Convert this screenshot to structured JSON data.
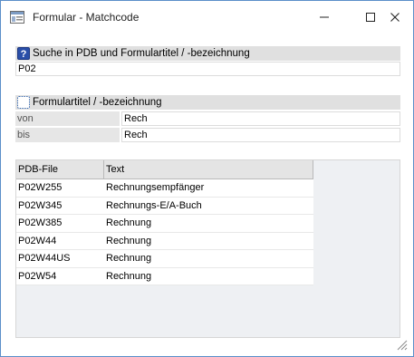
{
  "window": {
    "title": "Formular - Matchcode",
    "icons": {
      "app": "form-window-icon",
      "minimize": "minimize-icon",
      "maximize": "maximize-icon",
      "close": "close-icon"
    }
  },
  "search_section": {
    "header_icon": "help-question-icon",
    "header_label": "Suche in PDB und Formulartitel / -bezeichnung",
    "value": "P02"
  },
  "range_section": {
    "header_icon": "dotted-selection-icon",
    "header_label": "Formulartitel / -bezeichnung",
    "rows": [
      {
        "label": "von",
        "value": "Rech"
      },
      {
        "label": "bis",
        "value": "Rech"
      }
    ]
  },
  "results": {
    "columns": [
      "PDB-File",
      "Text"
    ],
    "rows": [
      [
        "P02W255",
        "Rechnungsempfänger"
      ],
      [
        "P02W345",
        "Rechnungs-E/A-Buch"
      ],
      [
        "P02W385",
        "Rechnung"
      ],
      [
        "P02W44",
        "Rechnung"
      ],
      [
        "P02W44US",
        "Rechnung"
      ],
      [
        "P02W54",
        "Rechnung"
      ]
    ]
  },
  "colors": {
    "window_border": "#5b8fc9",
    "section_header": "#e0e0e0",
    "grid_background": "#eef0f3",
    "help_icon": "#2a4fa8"
  }
}
